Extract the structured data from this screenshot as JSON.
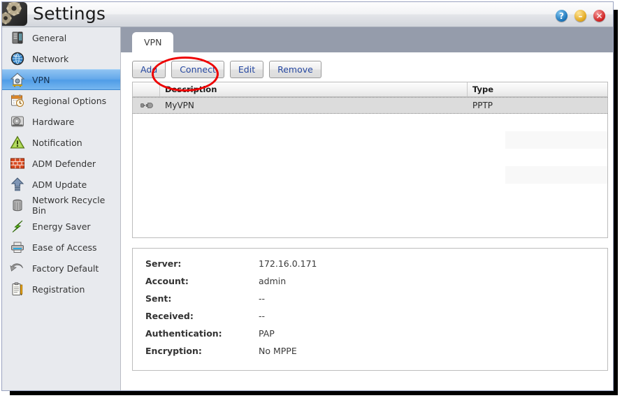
{
  "window": {
    "title": "Settings",
    "logo_icon": "gears-icon",
    "controls": [
      {
        "name": "help-button",
        "icon": "question-mark-icon",
        "glyph": "?",
        "color": "#1a73b8"
      },
      {
        "name": "minimize-button",
        "icon": "minus-icon",
        "glyph": "–",
        "color": "#e0a51b"
      },
      {
        "name": "close-button",
        "icon": "close-x-icon",
        "glyph": "✕",
        "color": "#cf2020"
      }
    ]
  },
  "sidebar": {
    "items": [
      {
        "label": "General",
        "icon": "server-tower-icon",
        "selected": false
      },
      {
        "label": "Network",
        "icon": "globe-icon",
        "selected": false
      },
      {
        "label": "VPN",
        "icon": "vpn-house-icon",
        "selected": true
      },
      {
        "label": "Regional Options",
        "icon": "calendar-clock-icon",
        "selected": false
      },
      {
        "label": "Hardware",
        "icon": "hard-disk-icon",
        "selected": false
      },
      {
        "label": "Notification",
        "icon": "warning-triangle-icon",
        "selected": false
      },
      {
        "label": "ADM Defender",
        "icon": "brick-firewall-icon",
        "selected": false
      },
      {
        "label": "ADM Update",
        "icon": "up-arrow-icon",
        "selected": false
      },
      {
        "label": "Network Recycle Bin",
        "icon": "trash-bin-icon",
        "selected": false
      },
      {
        "label": "Energy Saver",
        "icon": "green-bolt-icon",
        "selected": false
      },
      {
        "label": "Ease of Access",
        "icon": "printer-icon",
        "selected": false
      },
      {
        "label": "Factory Default",
        "icon": "undo-arrow-icon",
        "selected": false
      },
      {
        "label": "Registration",
        "icon": "clipboard-icon",
        "selected": false
      }
    ]
  },
  "main": {
    "tabs": [
      {
        "label": "VPN",
        "active": true
      }
    ],
    "toolbar": {
      "add_label": "Add",
      "connect_label": "Connect",
      "edit_label": "Edit",
      "remove_label": "Remove",
      "highlighted_button": "Connect",
      "highlight_color": "#ee0000"
    },
    "table": {
      "columns": [
        "Description",
        "Type"
      ],
      "rows": [
        {
          "icon": "connector-plug-icon",
          "description": "MyVPN",
          "type": "PPTP",
          "selected": true
        }
      ],
      "empty_row_count": 7
    },
    "details": [
      {
        "label": "Server:",
        "value": "172.16.0.171"
      },
      {
        "label": "Account:",
        "value": "admin"
      },
      {
        "label": "Sent:",
        "value": "--"
      },
      {
        "label": "Received:",
        "value": "--"
      },
      {
        "label": "Authentication:",
        "value": "PAP"
      },
      {
        "label": "Encryption:",
        "value": "No MPPE"
      }
    ]
  }
}
